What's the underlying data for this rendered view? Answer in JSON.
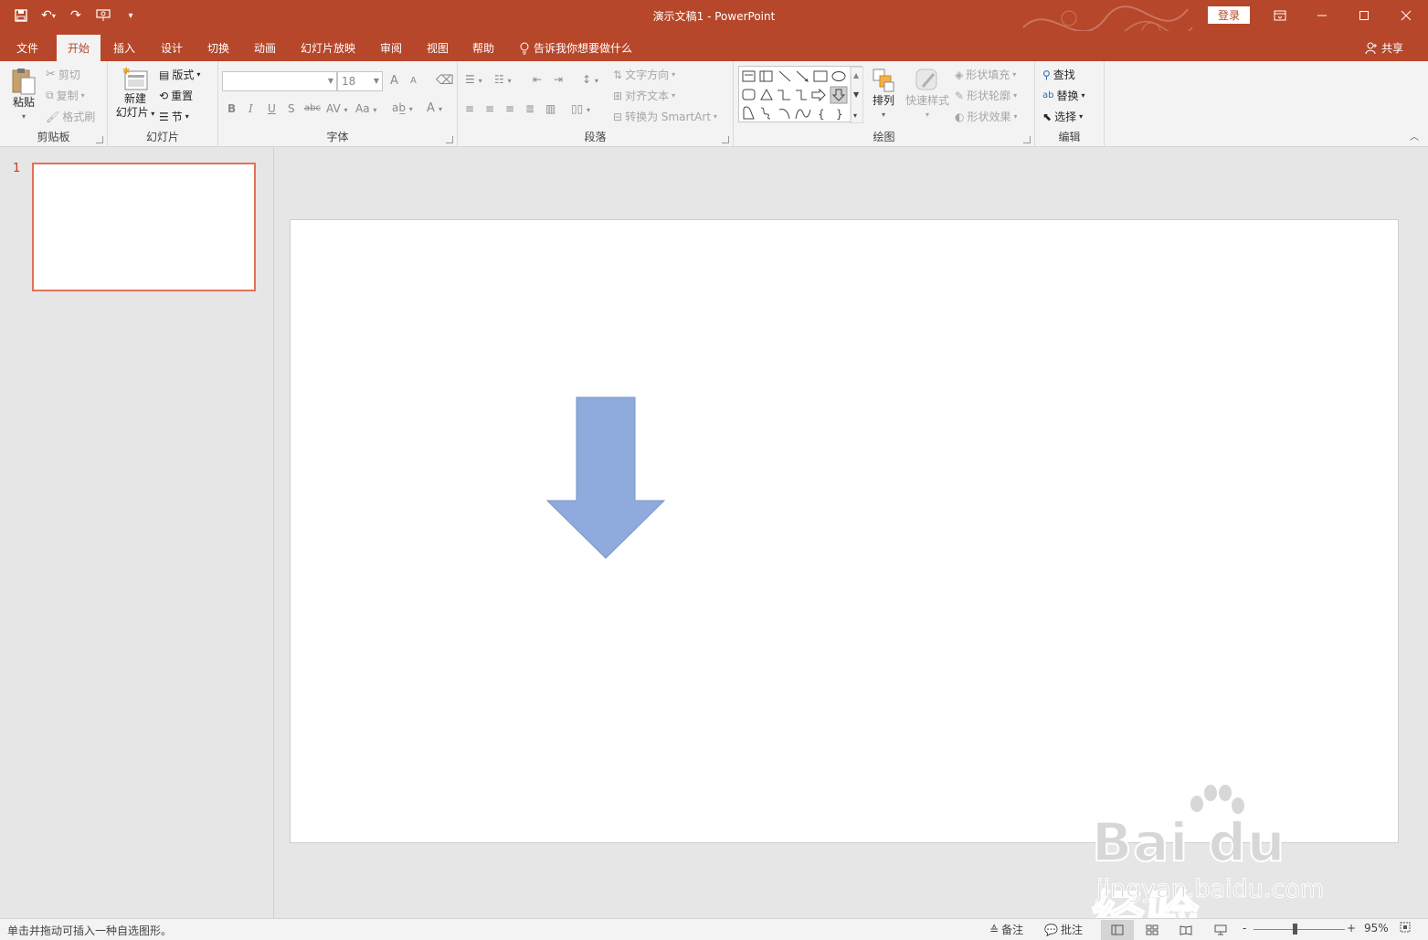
{
  "titlebar": {
    "title": "演示文稿1  -  PowerPoint",
    "login": "登录",
    "qat_customize": "▾"
  },
  "tabs": [
    {
      "label": "文件"
    },
    {
      "label": "开始"
    },
    {
      "label": "插入"
    },
    {
      "label": "设计"
    },
    {
      "label": "切换"
    },
    {
      "label": "动画"
    },
    {
      "label": "幻灯片放映"
    },
    {
      "label": "审阅"
    },
    {
      "label": "视图"
    },
    {
      "label": "帮助"
    }
  ],
  "tellme": "告诉我你想要做什么",
  "share": "共享",
  "ribbon": {
    "clipboard": {
      "label": "剪贴板",
      "paste": "粘贴",
      "cut": "剪切",
      "copy": "复制",
      "format_painter": "格式刷"
    },
    "slides": {
      "label": "幻灯片",
      "new_slide_1": "新建",
      "new_slide_2": "幻灯片",
      "layout": "版式",
      "reset": "重置",
      "section": "节"
    },
    "font": {
      "label": "字体",
      "font_name": "",
      "font_size": "18",
      "bold": "B",
      "italic": "I",
      "underline": "U",
      "shadow": "S",
      "strike": "abc",
      "spacing": "AV",
      "case": "Aa",
      "grow": "A",
      "shrink": "A",
      "color": "A"
    },
    "paragraph": {
      "label": "段落",
      "text_direction": "文字方向",
      "align_text": "对齐文本",
      "smartart": "转换为 SmartArt"
    },
    "drawing": {
      "label": "绘图",
      "arrange": "排列",
      "quick_styles": "快速样式",
      "shape_fill": "形状填充",
      "shape_outline": "形状轮廓",
      "shape_effects": "形状效果"
    },
    "editing": {
      "label": "编辑",
      "find": "查找",
      "replace": "替换",
      "select": "选择"
    }
  },
  "thumbnails": [
    {
      "number": "1"
    }
  ],
  "slide": {
    "shape_color": "#8faadc",
    "shape_stroke": "#7b96c8"
  },
  "watermark": {
    "brand": "Bai du 经验",
    "url": "jingyan.baidu.com"
  },
  "status": {
    "message": "单击并拖动可插入一种自选图形。",
    "notes": "备注",
    "comments": "批注",
    "zoom_minus": "-",
    "zoom_plus": "+",
    "zoom": "95%"
  },
  "colors": {
    "accent": "#b7472a",
    "selection": "#e0735a"
  }
}
